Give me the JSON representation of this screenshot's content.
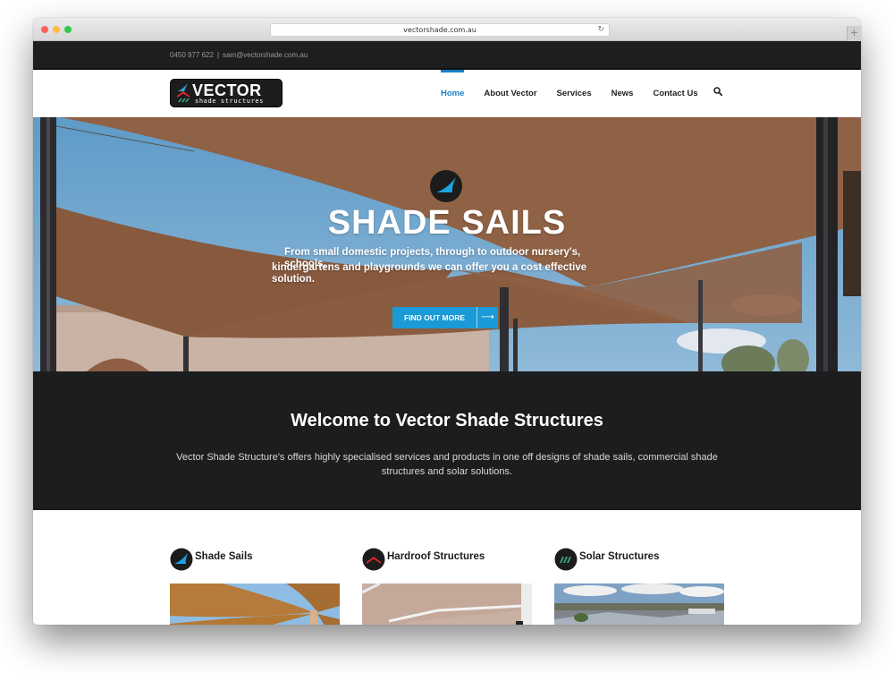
{
  "browser": {
    "url": "vectorshade.com.au",
    "new_tab_label": "+"
  },
  "topbar": {
    "phone": "0450 977 622",
    "separator": "|",
    "email": "sam@vectorshade.com.au"
  },
  "logo": {
    "wordmark": "VECTOR",
    "tagline": "shade structures"
  },
  "nav": {
    "items": [
      {
        "label": "Home",
        "active": true
      },
      {
        "label": "About Vector",
        "active": false
      },
      {
        "label": "Services",
        "active": false
      },
      {
        "label": "News",
        "active": false
      },
      {
        "label": "Contact Us",
        "active": false
      }
    ],
    "search_icon": "search-icon"
  },
  "hero": {
    "icon": "shade-sail-icon",
    "title": "SHADE SAILS",
    "text_line1": "From small domestic projects, through to outdoor nursery's,",
    "text_line1b": "schools,",
    "text_line2": "kindergartens and playgrounds  we can offer you a cost effective",
    "text_line3": "solution.",
    "button_label": "FIND OUT MORE",
    "button_arrow": "⟶"
  },
  "welcome": {
    "title": "Welcome to Vector Shade Structures",
    "body": "Vector Shade Structure's offers highly specialised services and products in one off designs of shade sails, commercial shade structures and solar solutions."
  },
  "services": [
    {
      "title": "Shade Sails",
      "icon": "shade-sail-icon"
    },
    {
      "title": "Hardroof Structures",
      "icon": "hardroof-icon"
    },
    {
      "title": "Solar Structures",
      "icon": "solar-icon"
    }
  ],
  "colors": {
    "accent": "#1a7fc0",
    "button": "#1a9ad6",
    "dark_bg": "#1c1d1f",
    "sail_brown": "#8f6145",
    "hardroof_red": "#e0262c",
    "solar_green": "#3aa080"
  }
}
